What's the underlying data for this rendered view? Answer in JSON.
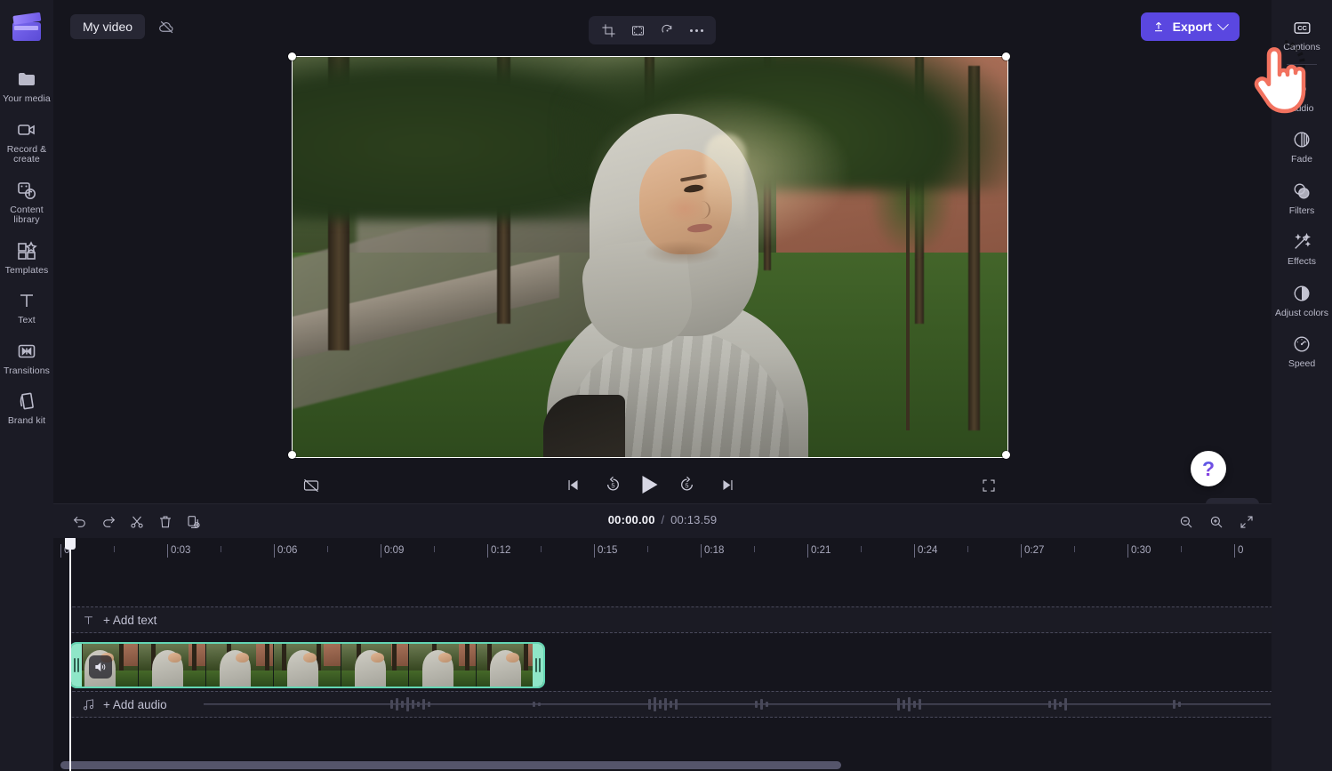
{
  "app": {
    "name": "Clipchamp video editor",
    "logo_icon": "clapperboard-logo"
  },
  "topbar": {
    "project_title": "My video",
    "cloud_icon": "cloud-off-icon",
    "tools": [
      {
        "name": "crop-button",
        "icon": "crop-icon"
      },
      {
        "name": "fit-fill-button",
        "icon": "fit-frame-icon"
      },
      {
        "name": "rotate-button",
        "icon": "rotate-icon"
      },
      {
        "name": "more-options-button",
        "icon": "ellipsis-icon"
      }
    ],
    "export_label": "Export",
    "export_icon": "upload-icon",
    "export_chevron": "chevron-down-icon",
    "export_color": "#5a47e0",
    "aspect_ratio": "16:9"
  },
  "left_sidebar": {
    "items": [
      {
        "label": "Your media",
        "icon": "folder-icon",
        "name": "sidebar-item-your-media"
      },
      {
        "label": "Record & create",
        "icon": "video-camera-icon",
        "name": "sidebar-item-record-create"
      },
      {
        "label": "Content library",
        "icon": "content-library-icon",
        "name": "sidebar-item-content-library"
      },
      {
        "label": "Templates",
        "icon": "templates-icon",
        "name": "sidebar-item-templates"
      },
      {
        "label": "Text",
        "icon": "text-icon",
        "name": "sidebar-item-text"
      },
      {
        "label": "Transitions",
        "icon": "transitions-icon",
        "name": "sidebar-item-transitions"
      },
      {
        "label": "Brand kit",
        "icon": "brand-kit-icon",
        "name": "sidebar-item-brand-kit"
      }
    ],
    "collapse_chevron": "chevron-right-icon"
  },
  "right_sidebar": {
    "items": [
      {
        "label": "Captions",
        "icon": "closed-captions-icon",
        "name": "property-captions"
      },
      {
        "label": "Audio",
        "icon": "audio-icon",
        "name": "property-audio"
      },
      {
        "label": "Fade",
        "icon": "fade-icon",
        "name": "property-fade"
      },
      {
        "label": "Filters",
        "icon": "filters-icon",
        "name": "property-filters"
      },
      {
        "label": "Effects",
        "icon": "effects-wand-icon",
        "name": "property-effects"
      },
      {
        "label": "Adjust colors",
        "icon": "adjust-colors-icon",
        "name": "property-adjust-colors"
      },
      {
        "label": "Speed",
        "icon": "speedometer-icon",
        "name": "property-speed"
      }
    ],
    "collapse_chevron": "chevron-left-icon"
  },
  "preview": {
    "selected": true,
    "controls": {
      "captions_toggle_icon": "captions-off-icon",
      "skip_start_icon": "skip-to-start-icon",
      "back5_icon": "rewind-5-icon",
      "back5_label": "5",
      "play_icon": "play-icon",
      "forward5_icon": "forward-5-icon",
      "forward5_label": "5",
      "skip_end_icon": "skip-to-end-icon",
      "fullscreen_icon": "fullscreen-icon"
    },
    "help_label": "?",
    "collapse_chevron": "chevron-down-icon"
  },
  "timeline_toolbar": {
    "buttons": [
      {
        "label": "Undo",
        "icon": "undo-icon",
        "name": "undo-button"
      },
      {
        "label": "Redo",
        "icon": "redo-icon",
        "name": "redo-button"
      },
      {
        "label": "Split",
        "icon": "scissors-icon",
        "name": "split-button"
      },
      {
        "label": "Delete",
        "icon": "trash-icon",
        "name": "delete-button"
      },
      {
        "label": "Duplicate",
        "icon": "duplicate-icon",
        "name": "duplicate-button"
      }
    ],
    "current_time": "00:00.00",
    "separator": "/",
    "total_time": "00:13.59",
    "zoom_out_icon": "zoom-out-icon",
    "zoom_in_icon": "zoom-in-icon",
    "fit_icon": "fit-to-screen-icon"
  },
  "timeline": {
    "ruler_labels": [
      "0",
      "0:03",
      "0:06",
      "0:09",
      "0:12",
      "0:15",
      "0:18",
      "0:21",
      "0:24",
      "0:27",
      "0:30",
      "0"
    ],
    "tracks": [
      {
        "name": "text-track",
        "label": "+ Add text",
        "icon": "text-t-icon"
      },
      {
        "name": "audio-track",
        "label": "+ Add audio",
        "icon": "music-note-icon"
      }
    ],
    "clip": {
      "name": "video-clip",
      "selected": true,
      "border_color": "#63d6b4",
      "volume_icon": "speaker-icon",
      "trim_handle_left": "trim-handle-left",
      "trim_handle_right": "trim-handle-right"
    },
    "playhead_position": "00:00.00"
  },
  "cursor": {
    "icon": "pointing-hand-cursor",
    "outline_color": "#f2725f",
    "fill_color": "#ffffff"
  }
}
